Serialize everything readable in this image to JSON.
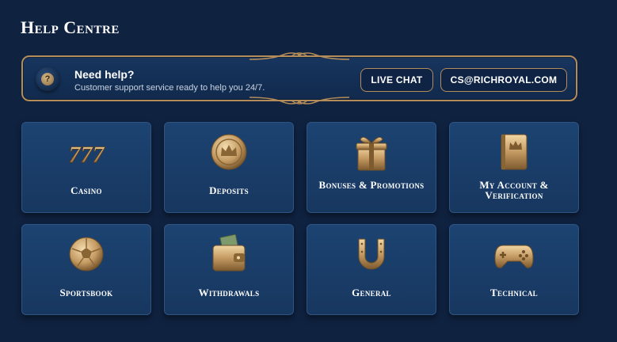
{
  "page": {
    "title": "Help Centre"
  },
  "help_banner": {
    "heading": "Need help?",
    "subtext": "Customer support service ready to help you 24/7.",
    "live_chat_label": "LIVE CHAT",
    "email_label": "CS@RICHROYAL.COM"
  },
  "categories": [
    {
      "label": "Casino",
      "icon": "slot-777-icon"
    },
    {
      "label": "Deposits",
      "icon": "crown-coin-icon"
    },
    {
      "label": "Bonuses & Promotions",
      "icon": "gift-box-icon"
    },
    {
      "label": "My Account & Verification",
      "icon": "account-book-icon"
    },
    {
      "label": "Sportsbook",
      "icon": "football-icon"
    },
    {
      "label": "Withdrawals",
      "icon": "wallet-icon"
    },
    {
      "label": "General",
      "icon": "horseshoe-icon"
    },
    {
      "label": "Technical",
      "icon": "gamepad-icon"
    }
  ],
  "colors": {
    "background": "#0f2240",
    "card": "#1c4372",
    "gold": "#b38c5a"
  }
}
